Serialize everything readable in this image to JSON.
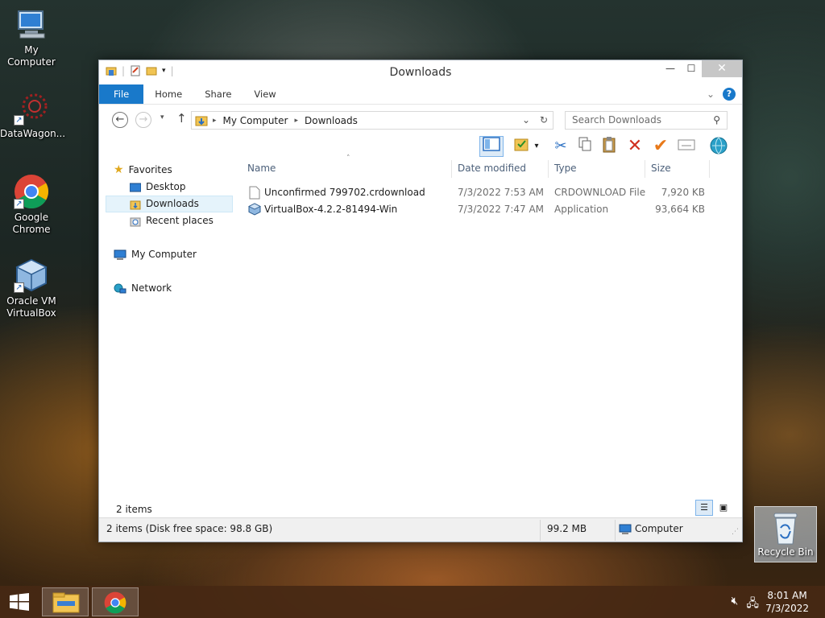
{
  "desktop": {
    "icons": [
      {
        "label": "My Computer",
        "icon": "computer-icon"
      },
      {
        "label": "DataWagon...",
        "icon": "datawagon-icon"
      },
      {
        "label": "Google Chrome",
        "icon": "chrome-icon"
      },
      {
        "label": "Oracle VM VirtualBox",
        "icon": "virtualbox-icon"
      }
    ],
    "recycle_bin": "Recycle Bin"
  },
  "window": {
    "title": "Downloads",
    "controls": {
      "minimize": "—",
      "maximize": "☐",
      "close": "✕"
    },
    "ribbon_tabs": [
      "File",
      "Home",
      "Share",
      "View"
    ],
    "address": {
      "segments": [
        "My Computer",
        "Downloads"
      ],
      "search_placeholder": "Search Downloads"
    },
    "nav_pane": {
      "favorites_label": "Favorites",
      "favorites": [
        "Desktop",
        "Downloads",
        "Recent places"
      ],
      "selected": "Downloads",
      "computer_label": "My Computer",
      "network_label": "Network"
    },
    "columns": [
      "Name",
      "Date modified",
      "Type",
      "Size"
    ],
    "files": [
      {
        "name": "Unconfirmed 799702.crdownload",
        "date": "7/3/2022 7:53 AM",
        "type": "CRDOWNLOAD File",
        "size": "7,920 KB"
      },
      {
        "name": "VirtualBox-4.2.2-81494-Win",
        "date": "7/3/2022 7:47 AM",
        "type": "Application",
        "size": "93,664 KB"
      }
    ],
    "items_count": "2 items",
    "status": {
      "left": "2 items (Disk free space: 98.8 GB)",
      "size": "99.2 MB",
      "location": "Computer"
    }
  },
  "taskbar": {
    "time": "8:01 AM",
    "date": "7/3/2022"
  },
  "colors": {
    "accent": "#1979ca",
    "selection": "#e5f3fb"
  }
}
